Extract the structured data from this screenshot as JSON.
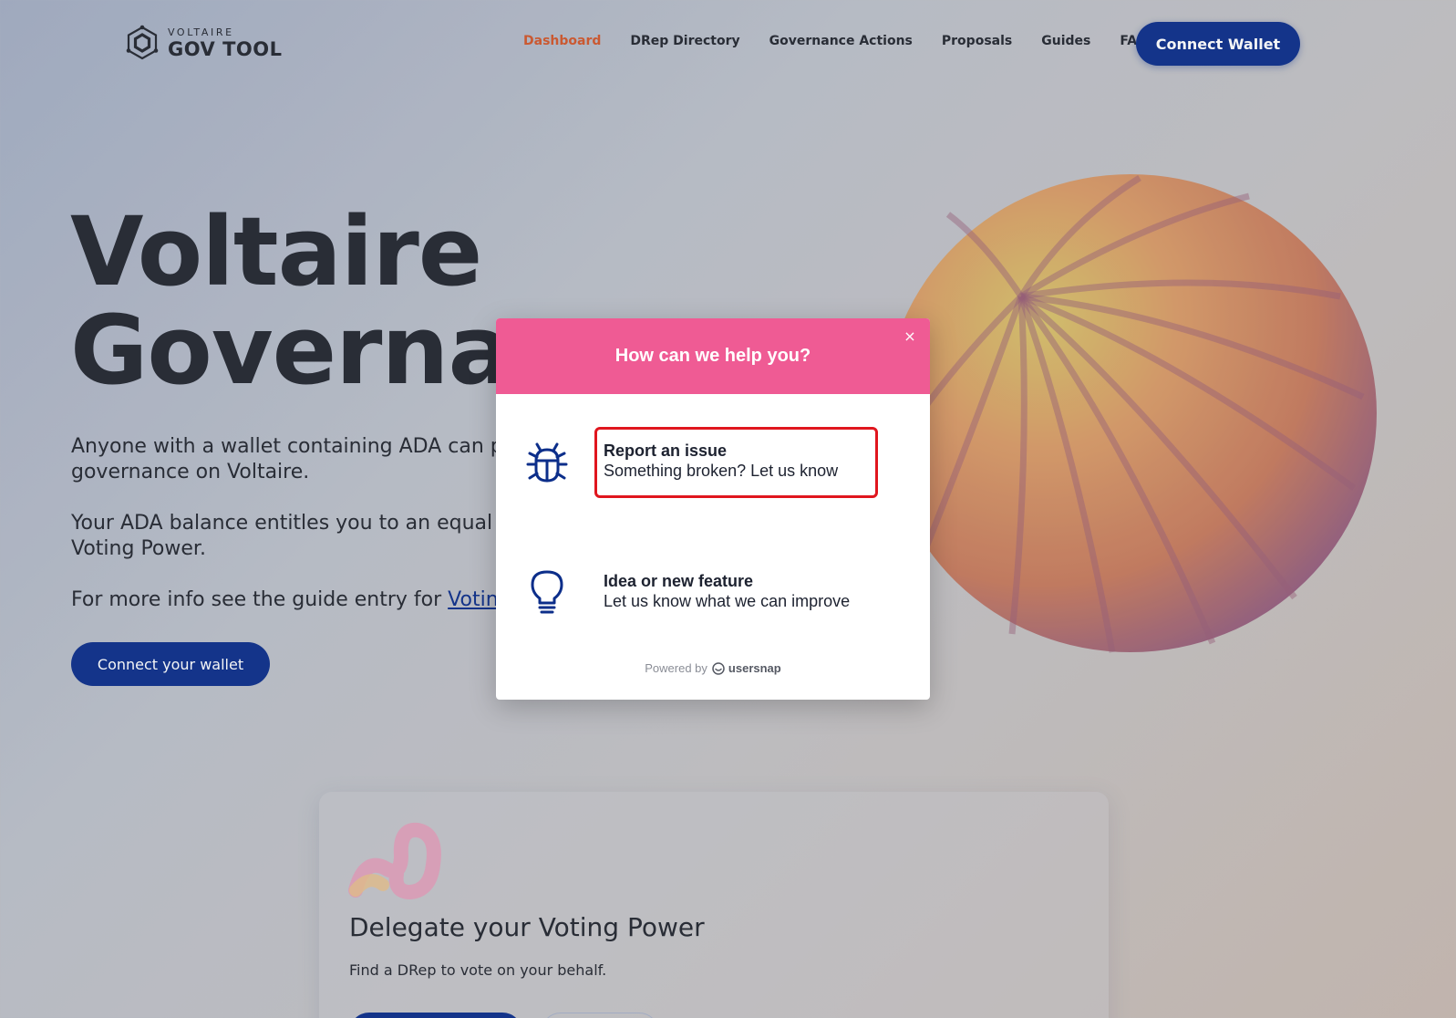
{
  "header": {
    "logo_small": "VOLTAIRE",
    "logo_big": "GOV TOOL",
    "nav": [
      {
        "label": "Dashboard",
        "active": true
      },
      {
        "label": "DRep Directory",
        "active": false
      },
      {
        "label": "Governance Actions",
        "active": false
      },
      {
        "label": "Proposals",
        "active": false
      },
      {
        "label": "Guides",
        "active": false
      },
      {
        "label": "FAQs",
        "active": false
      }
    ],
    "connect_label": "Connect Wallet"
  },
  "hero": {
    "title_line1": "Voltaire",
    "title_line2": "Governar",
    "p1": "Anyone with a wallet containing ADA can p governance on Voltaire.",
    "p2": "Your ADA balance entitles you to an equal Voting Power.",
    "p3_prefix": "For more info see the guide entry for ",
    "p3_link": "Voting",
    "connect_label": "Connect your wallet"
  },
  "card": {
    "title": "Delegate your Voting Power",
    "description": "Find a DRep to vote on your behalf."
  },
  "modal": {
    "title": "How can we help you?",
    "close_glyph": "×",
    "options": [
      {
        "title": "Report an issue",
        "subtitle": "Something broken? Let us know",
        "icon": "bug-icon"
      },
      {
        "title": "Idea or new feature",
        "subtitle": "Let us know what we can improve",
        "icon": "lightbulb-icon"
      }
    ],
    "powered_prefix": "Powered by",
    "powered_brand": "usersnap"
  },
  "colors": {
    "brand_blue": "#0c2e8a",
    "active_nav": "#d2562a",
    "modal_header": "#ef5b94",
    "highlight": "#e0161e"
  }
}
